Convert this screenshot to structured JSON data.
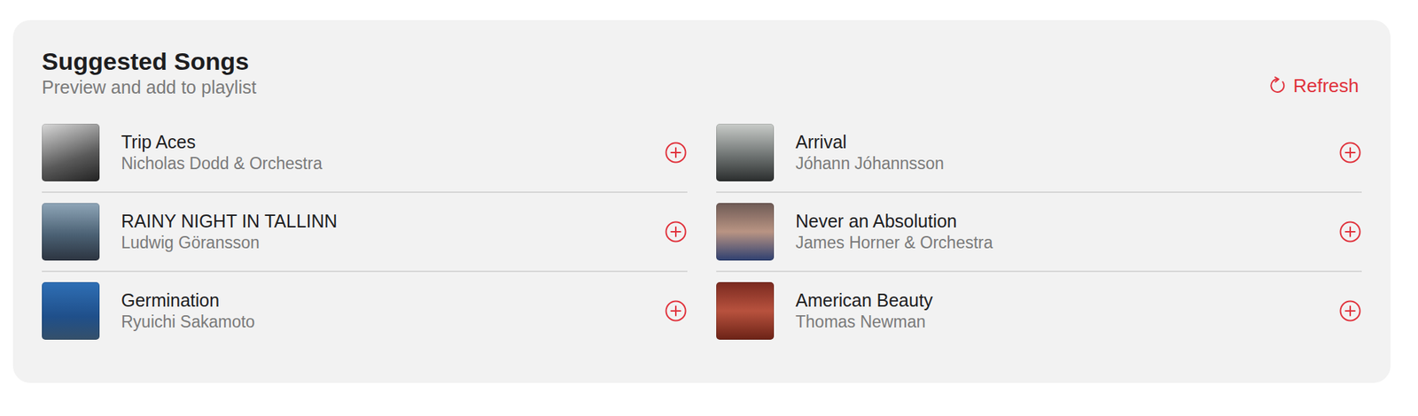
{
  "card": {
    "title": "Suggested Songs",
    "subtitle": "Preview and add to playlist",
    "refresh": "Refresh"
  },
  "columns": [
    [
      {
        "title": "Trip Aces",
        "artist": "Nicholas Dodd & Orchestra"
      },
      {
        "title": "RAINY NIGHT IN TALLINN",
        "artist": "Ludwig Göransson"
      },
      {
        "title": "Germination",
        "artist": "Ryuichi Sakamoto"
      }
    ],
    [
      {
        "title": "Arrival",
        "artist": "Jóhann Jóhannsson"
      },
      {
        "title": "Never an Absolution",
        "artist": "James Horner & Orchestra"
      },
      {
        "title": "American Beauty",
        "artist": "Thomas Newman"
      }
    ]
  ]
}
